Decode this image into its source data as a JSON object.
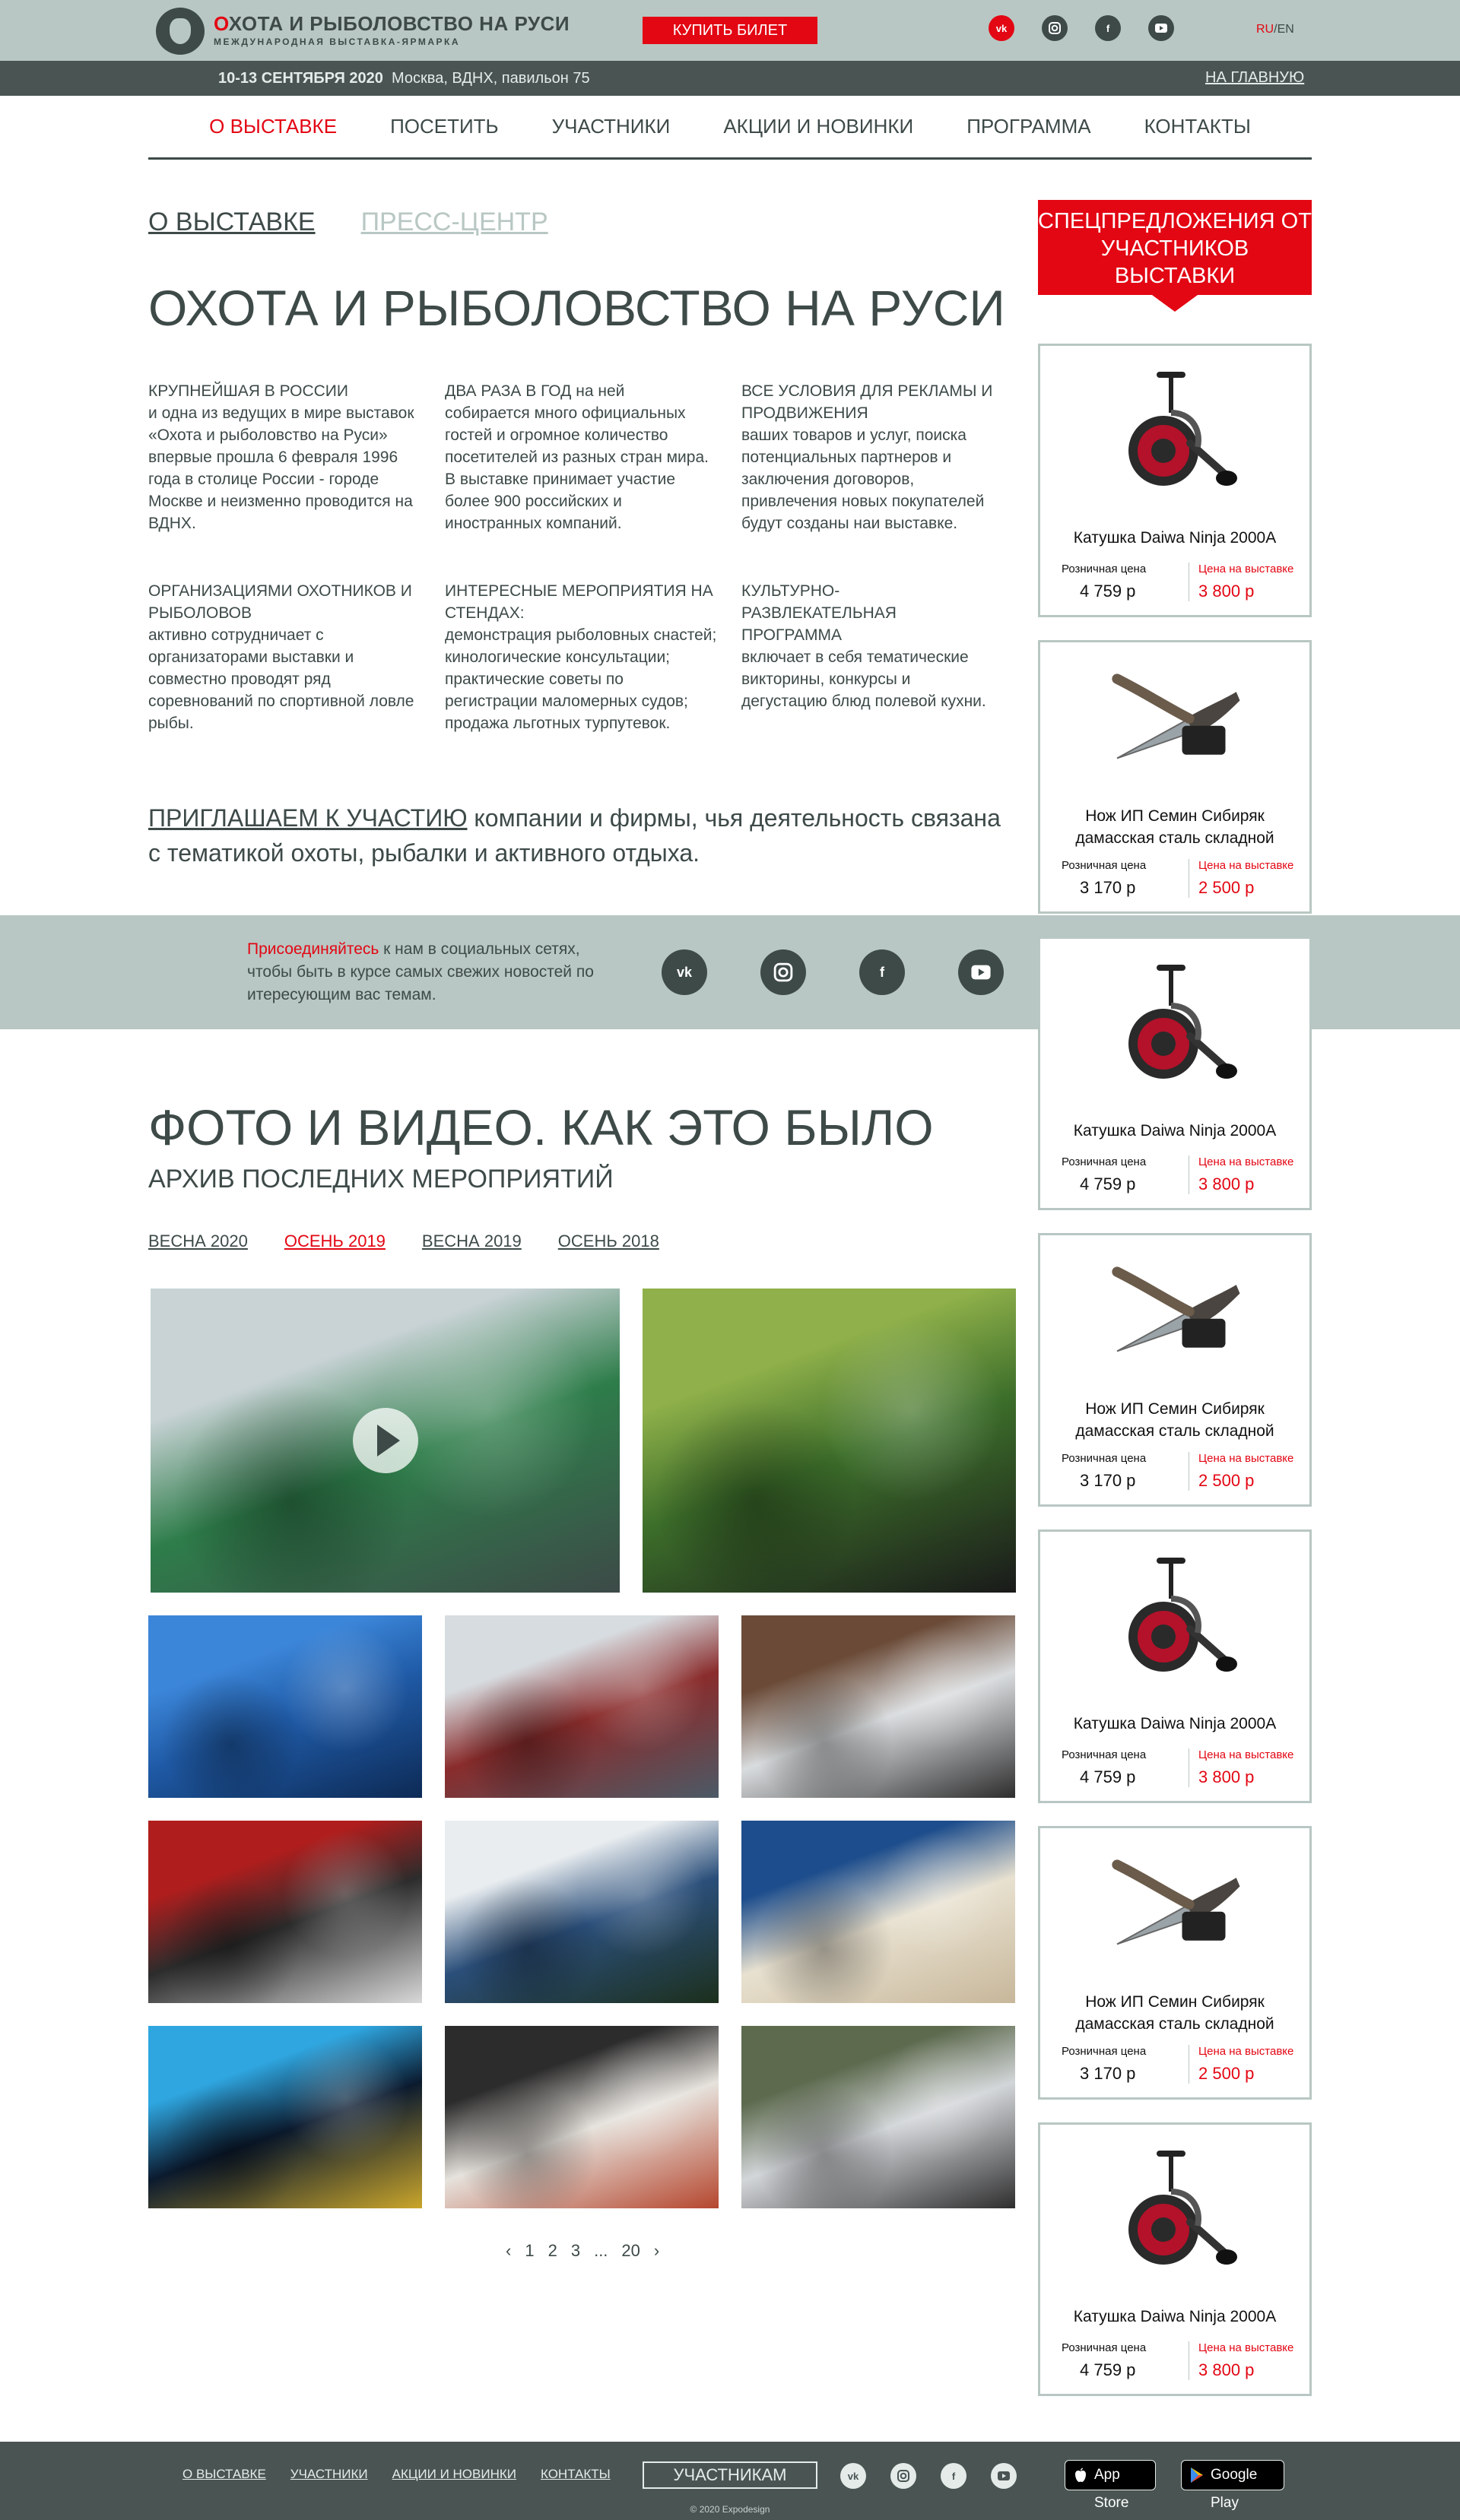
{
  "header": {
    "logo_title_first": "О",
    "logo_title_rest": "ХОТА И РЫБОЛОВСТВО НА РУСИ",
    "logo_subtitle": "МЕЖДУНАРОДНАЯ ВЫСТАВКА-ЯРМАРКА",
    "buy_ticket": "КУПИТЬ БИЛЕТ",
    "social": [
      "vk-icon",
      "instagram-icon",
      "facebook-icon",
      "youtube-icon"
    ],
    "lang_ru": "RU",
    "lang_sep": "/",
    "lang_en": "EN"
  },
  "subbar": {
    "dates": "10-13 СЕНТЯБРЯ 2020",
    "place": "Москва, ВДНХ, павильон 75",
    "home_link": "НА ГЛАВНУЮ"
  },
  "nav": {
    "items": [
      "О ВЫСТАВКЕ",
      "ПОСЕТИТЬ",
      "УЧАСТНИКИ",
      "АКЦИИ И НОВИНКИ",
      "ПРОГРАММА",
      "КОНТАКТЫ"
    ],
    "active_index": 0
  },
  "about": {
    "tabs": [
      "О ВЫСТАВКЕ",
      "ПРЕСС-ЦЕНТР"
    ],
    "title": "ОХОТА И РЫБОЛОВСТВО НА РУСИ",
    "facts": [
      {
        "head": "КРУПНЕЙШАЯ В РОССИИ",
        "body": "и одна из ведущих в мире выставок «Охота и рыболовство на Руси» впервые прошла 6 февраля 1996 года в столице России - городе Москве и неизменно проводится на ВДНХ."
      },
      {
        "head": "ДВА РАЗА В ГОД на ней",
        "body": "собирается много официальных гостей и огромное количество посетителей из разных стран мира. В выставке принимает участие более 900 российских и иностранных компаний."
      },
      {
        "head": "ВСЕ УСЛОВИЯ ДЛЯ РЕКЛАМЫ И ПРОДВИЖЕНИЯ",
        "body": "ваших товаров и услуг, поиска потенциальных партнеров и заключения договоров, привлечения новых покупателей будут созданы наи выставке."
      },
      {
        "head": "ОРГАНИЗАЦИЯМИ ОХОТНИКОВ И РЫБОЛОВОВ",
        "body": "активно сотрудничает с организаторами выставки и совместно проводят ряд соревнований по спортивной ловле рыбы."
      },
      {
        "head": "ИНТЕРЕСНЫЕ МЕРОПРИЯТИЯ НА СТЕНДАХ:",
        "body": "демонстрация рыболовных снастей; кинологические консультации; практические советы по регистрации маломерных судов; продажа льготных турпутевок."
      },
      {
        "head": "КУЛЬТУРНО-РАЗВЛЕКАТЕЛЬНАЯ ПРОГРАММА",
        "body": "включает в себя тематические викторины, конкурсы и дегустацию блюд полевой кухни."
      }
    ],
    "invite_lead": "ПРИГЛАШАЕМ К УЧАСТИЮ",
    "invite_rest": " компании и фирмы, чья деятельность связана  с  тематикой охоты, рыбалки и активного отдыха."
  },
  "band": {
    "highlight": "Присоединяйтесь",
    "text": " к нам в  социальных сетях, чтобы быть в курсе самых свежих новостей по итересующим вас темам.",
    "social": [
      "vk-icon",
      "instagram-icon",
      "facebook-icon",
      "youtube-icon"
    ]
  },
  "gallery": {
    "title": "ФОТО И ВИДЕО. КАК ЭТО БЫЛО",
    "subtitle": "АРХИВ ПОСЛЕДНИХ МЕРОПРИЯТИЙ",
    "seasons": [
      "ВЕСНА 2020",
      "ОСЕНЬ 2019",
      "ВЕСНА 2019",
      "ОСЕНЬ 2018"
    ],
    "active_season": 1,
    "photos": [
      {
        "name": "expo-stand-video",
        "colors": [
          "#2e7d4a",
          "#c9d3d6",
          "#3d4a48"
        ],
        "video": true
      },
      {
        "name": "fishing-bait-stand",
        "colors": [
          "#3c6e2a",
          "#8fb04a",
          "#1a1a1a"
        ],
        "video": false
      },
      {
        "name": "boat-motors",
        "colors": [
          "#1f5aa6",
          "#3c86d9",
          "#0d2a55"
        ],
        "video": false
      },
      {
        "name": "exhibition-hall",
        "colors": [
          "#8a2c2c",
          "#d7dce0",
          "#4b5a66"
        ],
        "video": false
      },
      {
        "name": "boat-cockpit",
        "colors": [
          "#d9dcde",
          "#6b4b38",
          "#2d2d2d"
        ],
        "video": false
      },
      {
        "name": "atv-vehicle",
        "colors": [
          "#2c2c2c",
          "#b01d1d",
          "#d8d8d8"
        ],
        "video": false
      },
      {
        "name": "yamaha-boat",
        "colors": [
          "#2b4f7a",
          "#e9edf0",
          "#1c2f1c"
        ],
        "video": false
      },
      {
        "name": "hostess-stand",
        "colors": [
          "#e8e1d0",
          "#1d4d8c",
          "#c7b79a"
        ],
        "video": false
      },
      {
        "name": "ice-fishing-light",
        "colors": [
          "#0b1a2e",
          "#2fa6e0",
          "#c9a52b"
        ],
        "video": false
      },
      {
        "name": "opening-ceremony",
        "colors": [
          "#e6e2dc",
          "#2c2c2c",
          "#b5462e"
        ],
        "video": false
      },
      {
        "name": "visitors-counter",
        "colors": [
          "#d3d6d9",
          "#5d6a4e",
          "#2e2e2e"
        ],
        "video": false
      }
    ],
    "pager": [
      "1",
      "2",
      "3",
      "...",
      "20"
    ]
  },
  "promo": {
    "head": "СПЕЦПРЕДЛОЖЕНИЯ ОТ УЧАСТНИКОВ ВЫСТАВКИ",
    "retail_label": "Розничная цена",
    "expo_label": "Цена на выставке",
    "cards": [
      {
        "kind": "reel",
        "name": "Катушка Daiwa Ninja 2000A",
        "retail": "4 759 р",
        "expo": "3 800 р"
      },
      {
        "kind": "knife",
        "name": "Нож ИП Семин Сибиряк дамасская сталь складной",
        "retail": "3 170 р",
        "expo": "2 500 р"
      },
      {
        "kind": "reel",
        "name": "Катушка Daiwa Ninja 2000A",
        "retail": "4 759 р",
        "expo": "3 800 р"
      },
      {
        "kind": "knife",
        "name": "Нож ИП Семин Сибиряк дамасская сталь складной",
        "retail": "3 170 р",
        "expo": "2 500 р"
      },
      {
        "kind": "reel",
        "name": "Катушка Daiwa Ninja 2000A",
        "retail": "4 759 р",
        "expo": "3 800 р"
      },
      {
        "kind": "knife",
        "name": "Нож ИП Семин Сибиряк дамасская сталь складной",
        "retail": "3 170 р",
        "expo": "2 500 р"
      },
      {
        "kind": "reel",
        "name": "Катушка Daiwa Ninja 2000A",
        "retail": "4 759 р",
        "expo": "3 800 р"
      }
    ]
  },
  "footer": {
    "links": [
      "О ВЫСТАВКЕ",
      "УЧАСТНИКИ",
      "АКЦИИ И НОВИНКИ",
      "КОНТАКТЫ"
    ],
    "participants_button": "УЧАСТНИКАМ",
    "social": [
      "vk-icon",
      "instagram-icon",
      "facebook-icon",
      "youtube-icon"
    ],
    "app_store": "App Store",
    "google_play": "Google Play",
    "copyright": "© 2020 Expodesign"
  },
  "colors": {
    "accent": "#e30613",
    "dark": "#3d4a48",
    "sage": "#b8c7c3",
    "bar": "#4a5553"
  }
}
